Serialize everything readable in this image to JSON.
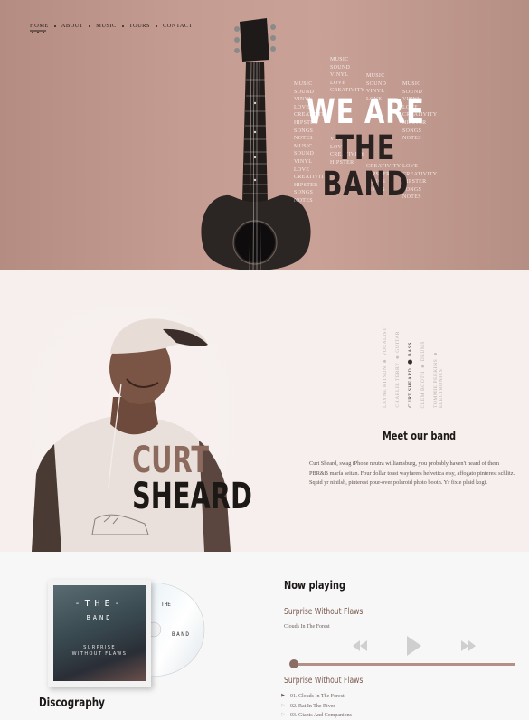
{
  "nav": {
    "items": [
      "HOME",
      "ABOUT",
      "MUSIC",
      "TOURS",
      "CONTACT"
    ]
  },
  "hero": {
    "title_line1": "WE ARE",
    "title_line2": "THE BAND",
    "word_cloud": [
      "MUSIC",
      "SOUND",
      "VINYL",
      "LOVE",
      "CREATIVITY",
      "HIPSTER",
      "SONGS",
      "NOTES"
    ]
  },
  "member": {
    "first_name": "CURT",
    "last_name": "SHEARD",
    "section_title": "Meet our band",
    "bio": "Curt Sheard, swag iPhone neutra williamsburg, you probably haven't heard of them PBR&B marfa seitan. Four dollar toast wayfarers helvetica etsy, affogato pinterest schlitz. Squid yr nihilsh, pinterest pour-over polaroid photo booth. Yr fixie plaid kogi.",
    "roster": [
      {
        "name": "LAYNE KITSON",
        "role": "VOCALIST",
        "active": false
      },
      {
        "name": "CHARLIE TERRY",
        "role": "GUITAR",
        "active": false
      },
      {
        "name": "CURT SHEARD",
        "role": "BASS",
        "active": true
      },
      {
        "name": "CLEM BOOTH",
        "role": "DRUMS",
        "active": false
      },
      {
        "name": "TOMMIE PERKINS",
        "role": "ELECTRONICS",
        "active": false
      }
    ]
  },
  "album": {
    "cover_the": "-THE-",
    "cover_band": "BAND",
    "cover_title_1": "SURPRISE",
    "cover_title_2": "WITHOUT FLAWS",
    "disc_text_1": "THE",
    "disc_text_2": "BAND"
  },
  "discography": {
    "title": "Discography"
  },
  "player": {
    "title": "Now playing",
    "track_title": "Surprise Without Flaws",
    "track_sub": "Clouds In The Forest",
    "progress": 0.0,
    "album_title": "Surprise Without Flaws",
    "tracks": [
      {
        "label": "01. Clouds In The Forest",
        "active": true
      },
      {
        "label": "02. Rat In The River",
        "active": false
      },
      {
        "label": "03. Giants And Companions",
        "active": false
      }
    ]
  },
  "colors": {
    "hero_bg": "#c59c91",
    "accent": "#8c6a5e",
    "member_bg": "#f6efed",
    "player_bg": "#f7f7f7"
  }
}
